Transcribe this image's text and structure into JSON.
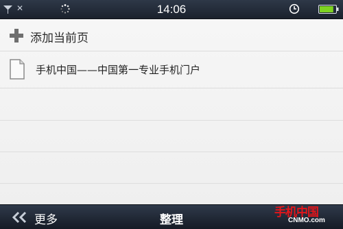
{
  "status_bar": {
    "time": "14:06",
    "no_service_symbol": "✕",
    "icons": [
      "signal-icon",
      "no-service-icon",
      "loading-icon",
      "alarm-icon",
      "battery-icon"
    ],
    "battery_level": 0.9,
    "accent_color": "#7ed321"
  },
  "content": {
    "add_current_page_label": "添加当前页",
    "bookmarks": [
      {
        "title": "手机中国——中国第一专业手机门户",
        "icon": "document-icon"
      }
    ]
  },
  "bottom_bar": {
    "more_label": "更多",
    "organize_label": "整理"
  },
  "watermark": {
    "logo_text": "手机中国",
    "url": "CNMO.com"
  }
}
